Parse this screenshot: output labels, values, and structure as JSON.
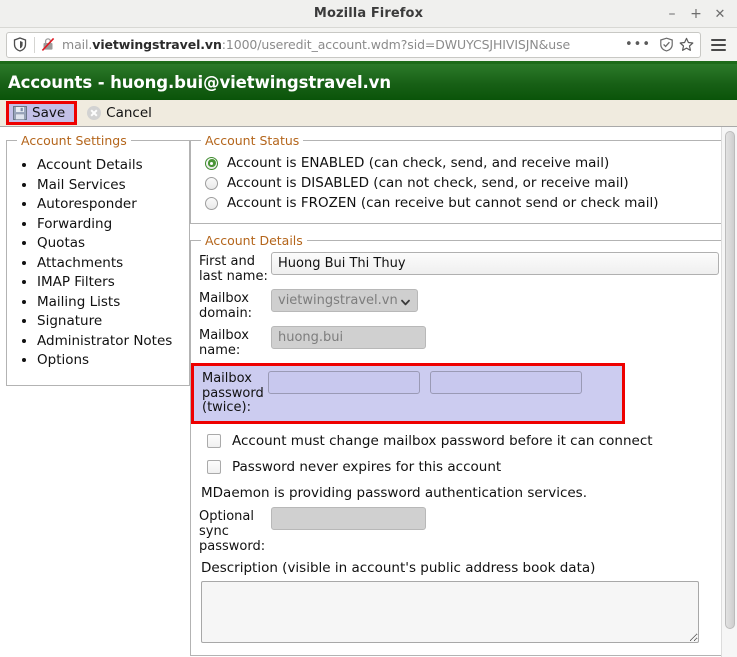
{
  "browser": {
    "window_title": "Mozilla Firefox",
    "window_buttons": {
      "minimize": "–",
      "maximize": "+",
      "close": "✕"
    },
    "url": {
      "prefix": "mail.",
      "domain": "vietwingstravel.vn",
      "rest": ":1000/useredit_account.wdm?sid=DWUYCSJHIVISJN&use",
      "full": "mail.vietwingstravel.vn:1000/useredit_account.wdm?sid=DWUYCSJHIVISJN&use"
    },
    "overflow_menu": "•••"
  },
  "page": {
    "header_title": "Accounts - huong.bui@vietwingstravel.vn"
  },
  "toolbar": {
    "save_label": "Save",
    "cancel_label": "Cancel"
  },
  "sidebar": {
    "legend": "Account Settings",
    "items": [
      {
        "label": "Account Details"
      },
      {
        "label": "Mail Services"
      },
      {
        "label": "Autoresponder"
      },
      {
        "label": "Forwarding"
      },
      {
        "label": "Quotas"
      },
      {
        "label": "Attachments"
      },
      {
        "label": "IMAP Filters"
      },
      {
        "label": "Mailing Lists"
      },
      {
        "label": "Signature"
      },
      {
        "label": "Administrator Notes"
      },
      {
        "label": "Options"
      }
    ]
  },
  "account_status": {
    "legend": "Account Status",
    "options": [
      {
        "label": "Account is ENABLED (can check, send, and receive mail)",
        "selected": true
      },
      {
        "label": "Account is DISABLED (can not check, send, or receive mail)",
        "selected": false
      },
      {
        "label": "Account is FROZEN (can receive but cannot send or check mail)",
        "selected": false
      }
    ]
  },
  "account_details": {
    "legend": "Account Details",
    "first_last_name": {
      "label": "First and last name:",
      "value": "Huong Bui Thi Thuy"
    },
    "mailbox_domain": {
      "label": "Mailbox domain:",
      "value": "vietwingstravel.vn"
    },
    "mailbox_name": {
      "label": "Mailbox name:",
      "value": "huong.bui"
    },
    "mailbox_password": {
      "label": "Mailbox password (twice):",
      "value1": "",
      "value2": ""
    },
    "must_change_password": {
      "label": "Account must change mailbox password before it can connect",
      "checked": false
    },
    "never_expires": {
      "label": "Password never expires for this account",
      "checked": false
    },
    "auth_note": "MDaemon is providing password authentication services.",
    "optional_sync_password": {
      "label": "Optional sync password:",
      "value": ""
    },
    "description": {
      "label": "Description (visible in account's public address book data)",
      "value": ""
    }
  },
  "colors": {
    "header_green": "#186016",
    "toolbar_cream": "#f0ebdf",
    "legend_orange": "#b4651b",
    "highlight_red": "#ee0000",
    "highlight_lavender": "#ccccf0",
    "radio_green": "#4b9a36"
  }
}
